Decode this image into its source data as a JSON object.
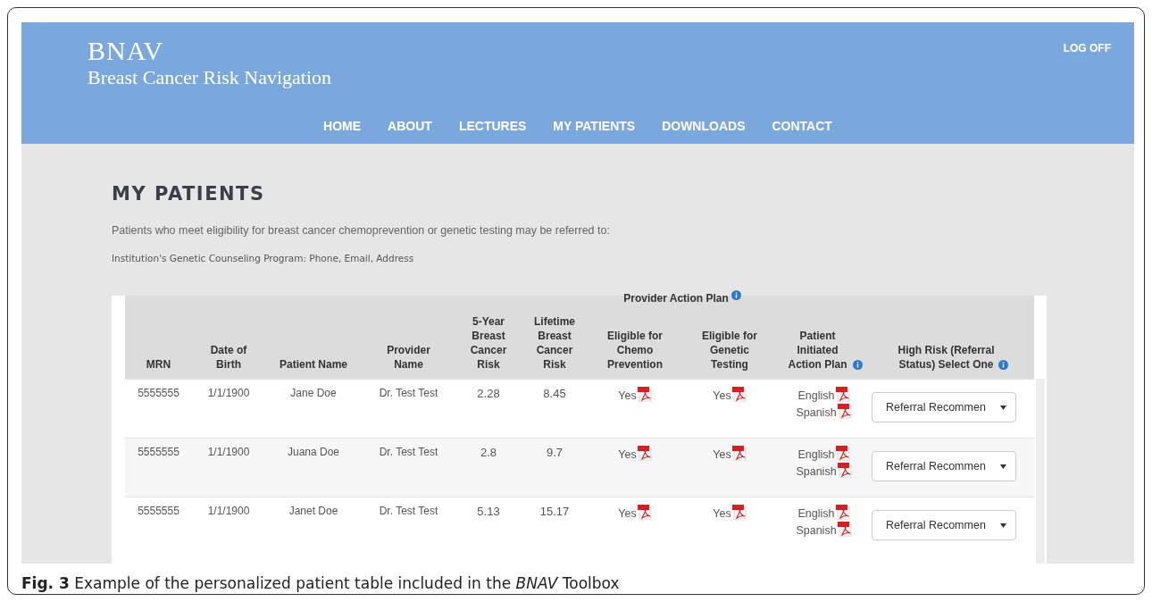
{
  "site": {
    "logo": "BNAV",
    "subtitle": "Breast Cancer Risk Navigation",
    "log_off": "LOG OFF"
  },
  "nav": [
    {
      "label": "HOME",
      "selected": false
    },
    {
      "label": "ABOUT",
      "selected": false
    },
    {
      "label": "LECTURES",
      "selected": false
    },
    {
      "label": "MY PATIENTS",
      "selected": false
    },
    {
      "label": "DOWNLOADS",
      "selected": false
    },
    {
      "label": "CONTACT",
      "selected": false
    }
  ],
  "page": {
    "title": "MY PATIENTS",
    "intro": "Patients who meet eligibility for breast cancer chemoprevention or genetic testing may be referred to:",
    "referral_info": "Institution's Genetic Counseling Program: Phone, Email, Address"
  },
  "table": {
    "group_header": {
      "label": "Provider Action Plan",
      "info": true
    },
    "columns": [
      {
        "label": "MRN",
        "info": false
      },
      {
        "label": "Date of Birth",
        "info": false
      },
      {
        "label": "Patient Name",
        "info": false
      },
      {
        "label": "Provider Name",
        "info": false
      },
      {
        "label": "5-Year Breast Cancer Risk",
        "info": false
      },
      {
        "label": "Lifetime Breast Cancer Risk",
        "info": false
      },
      {
        "label": "Eligible for Chemo Prevention",
        "info": false
      },
      {
        "label": "Eligible for Genetic Testing",
        "info": false
      },
      {
        "label": "Patient Initiated Action Plan",
        "info": true
      },
      {
        "label": "High Risk (Referral Status) Select One",
        "info": true
      }
    ],
    "rows": [
      {
        "mrn": "5555555",
        "dob": "1/1/1900",
        "patient": "Jane Doe",
        "provider": "Dr. Test Test",
        "risk_5yr": "2.28",
        "risk_lifetime": "8.45",
        "chemo": "Yes",
        "genetic": "Yes",
        "action_plans": [
          "English",
          "Spanish"
        ],
        "status": "Referral Recommen"
      },
      {
        "mrn": "5555555",
        "dob": "1/1/1900",
        "patient": "Juana Doe",
        "provider": "Dr. Test Test",
        "risk_5yr": "2.8",
        "risk_lifetime": "9.7",
        "chemo": "Yes",
        "genetic": "Yes",
        "action_plans": [
          "English",
          "Spanish"
        ],
        "status": "Referral Recommen"
      },
      {
        "mrn": "5555555",
        "dob": "1/1/1900",
        "patient": "Janet Doe",
        "provider": "Dr. Test Test",
        "risk_5yr": "5.13",
        "risk_lifetime": "15.17",
        "chemo": "Yes",
        "genetic": "Yes",
        "action_plans": [
          "English",
          "Spanish"
        ],
        "status": "Referral Recommen"
      }
    ]
  },
  "caption": "**Fig. 3** Example of the personalized patient table included in the *BNAV* Toolbox"
}
